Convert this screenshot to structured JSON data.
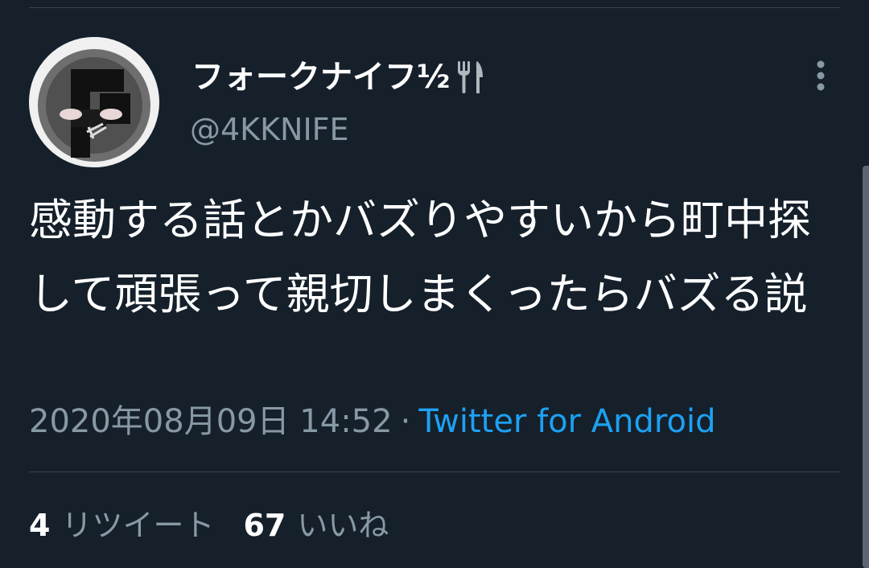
{
  "tweet": {
    "display_name": "フォークナイフ½",
    "name_emoji": "fork-and-knife-icon",
    "handle": "@4KKNIFE",
    "text": "感動する話とかバズりやすいから町中探して頑張って親切しまくったらバズる説",
    "timestamp": "2020年08月09日 14:52",
    "separator": "·",
    "source": "Twitter for Android"
  },
  "stats": {
    "retweets_count": "4",
    "retweets_label": "リツイート",
    "likes_count": "67",
    "likes_label": "いいね"
  },
  "colors": {
    "background": "#15202b",
    "text_primary": "#ffffff",
    "text_secondary": "#8899a6",
    "accent": "#1da1f2",
    "divider": "#38444d"
  }
}
